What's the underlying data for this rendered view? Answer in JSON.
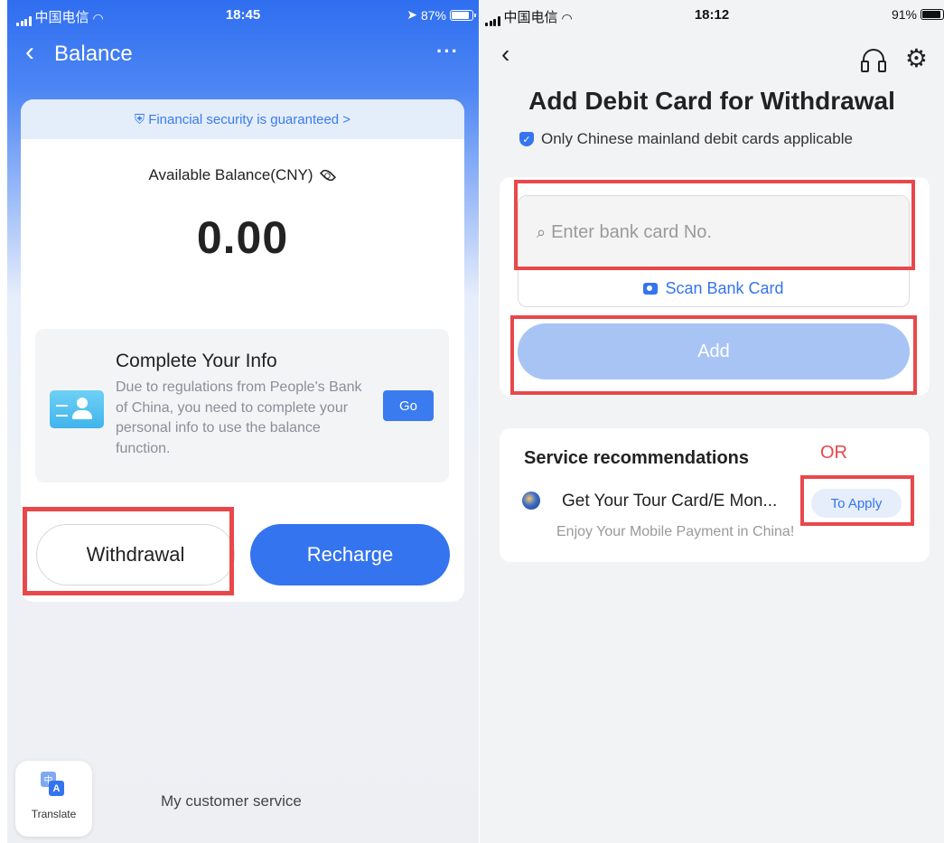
{
  "left_phone": {
    "status": {
      "carrier": "中国电信",
      "time": "18:45",
      "battery": "87%"
    },
    "nav": {
      "back_glyph": "‹",
      "title": "Balance",
      "more": "···"
    },
    "security_bar": "Financial security is guaranteed >",
    "balance_label": "Available Balance(CNY)",
    "balance_value": "0.00",
    "info_card": {
      "title": "Complete Your Info",
      "text": "Due to regulations from People's Bank of China, you need to complete your personal info to use the balance function.",
      "go_label": "Go"
    },
    "withdrawal_label": "Withdrawal",
    "recharge_label": "Recharge",
    "translate_label": "Translate",
    "customer_service": "My customer service"
  },
  "right_phone": {
    "status": {
      "carrier": "中国电信",
      "time": "18:12",
      "battery": "91%"
    },
    "nav": {
      "back_glyph": "‹"
    },
    "title": "Add Debit Card for Withdrawal",
    "note": "Only Chinese mainland debit cards applicable",
    "input": {
      "placeholder": "Enter bank card No.",
      "scan_label": "Scan Bank Card"
    },
    "add_label": "Add",
    "service": {
      "title": "Service recommendations",
      "or_label": "OR",
      "item_name": "Get Your Tour Card/E Mon...",
      "apply_label": "To Apply",
      "item_desc": "Enjoy Your Mobile Payment in China!"
    }
  },
  "colors": {
    "primary_blue": "#3574ef",
    "highlight_red": "#e8484b",
    "disabled_blue": "#a8c4f4"
  },
  "icons": [
    "signal-icon",
    "wifi-icon",
    "battery-icon",
    "location-icon",
    "back-icon",
    "more-icon",
    "shield-icon",
    "eye-icon",
    "id-card-icon",
    "translate-icon",
    "headset-icon",
    "gear-icon",
    "search-icon",
    "camera-icon",
    "tour-card-icon"
  ]
}
